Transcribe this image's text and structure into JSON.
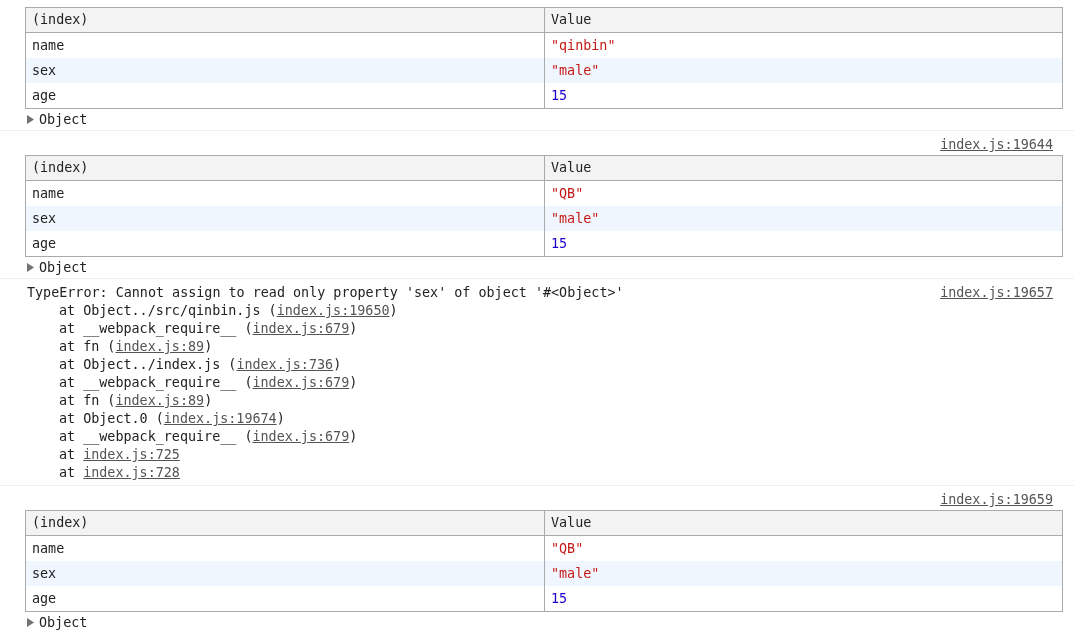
{
  "console_messages": [
    {
      "kind": "table",
      "columns": [
        "(index)",
        "Value"
      ],
      "rows": [
        {
          "key": "name",
          "value": "\"qinbin\"",
          "kind": "string"
        },
        {
          "key": "sex",
          "value": "\"male\"",
          "kind": "string"
        },
        {
          "key": "age",
          "value": "15",
          "kind": "number"
        }
      ],
      "object_label": "Object",
      "expanded": false
    },
    {
      "kind": "table",
      "source": "index.js:19644",
      "columns": [
        "(index)",
        "Value"
      ],
      "rows": [
        {
          "key": "name",
          "value": "\"QB\"",
          "kind": "string"
        },
        {
          "key": "sex",
          "value": "\"male\"",
          "kind": "string"
        },
        {
          "key": "age",
          "value": "15",
          "kind": "number"
        }
      ],
      "object_label": "Object",
      "expanded": false
    },
    {
      "kind": "error",
      "source": "index.js:19657",
      "message": "TypeError: Cannot assign to read only property 'sex' of object '#<Object>'",
      "stack": [
        {
          "text": "at Object../src/qinbin.js (",
          "link": "index.js:19650",
          "after": ")"
        },
        {
          "text": "at __webpack_require__ (",
          "link": "index.js:679",
          "after": ")"
        },
        {
          "text": "at fn (",
          "link": "index.js:89",
          "after": ")"
        },
        {
          "text": "at Object../index.js (",
          "link": "index.js:736",
          "after": ")"
        },
        {
          "text": "at __webpack_require__ (",
          "link": "index.js:679",
          "after": ")"
        },
        {
          "text": "at fn (",
          "link": "index.js:89",
          "after": ")"
        },
        {
          "text": "at Object.0 (",
          "link": "index.js:19674",
          "after": ")"
        },
        {
          "text": "at __webpack_require__ (",
          "link": "index.js:679",
          "after": ")"
        },
        {
          "text": "at ",
          "link": "index.js:725"
        },
        {
          "text": "at ",
          "link": "index.js:728"
        }
      ]
    },
    {
      "kind": "table",
      "source": "index.js:19659",
      "columns": [
        "(index)",
        "Value"
      ],
      "rows": [
        {
          "key": "name",
          "value": "\"QB\"",
          "kind": "string"
        },
        {
          "key": "sex",
          "value": "\"male\"",
          "kind": "string"
        },
        {
          "key": "age",
          "value": "15",
          "kind": "number"
        }
      ],
      "object_label": "Object",
      "expanded": false
    }
  ]
}
